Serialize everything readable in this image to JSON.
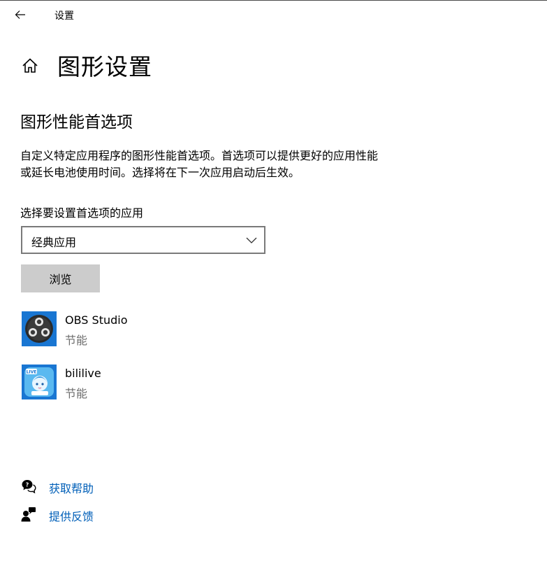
{
  "window": {
    "title": "设置"
  },
  "page": {
    "title": "图形设置"
  },
  "section": {
    "title": "图形性能首选项",
    "description_line1": "自定义特定应用程序的图形性能首选项。首选项可以提供更好的应用性能",
    "description_line2": "或延长电池使用时间。选择将在下一次应用启动后生效。"
  },
  "selector": {
    "label": "选择要设置首选项的应用",
    "value": "经典应用"
  },
  "browse": {
    "label": "浏览"
  },
  "apps": [
    {
      "name": "OBS Studio",
      "status": "节能",
      "icon": "obs-icon"
    },
    {
      "name": "bililive",
      "status": "节能",
      "icon": "bililive-icon"
    }
  ],
  "links": {
    "help": "获取帮助",
    "feedback": "提供反馈"
  },
  "colors": {
    "link": "#005fb8",
    "button_bg": "#cccccc",
    "status_text": "#6d6d6d",
    "dropdown_border": "#7a7a7a"
  }
}
